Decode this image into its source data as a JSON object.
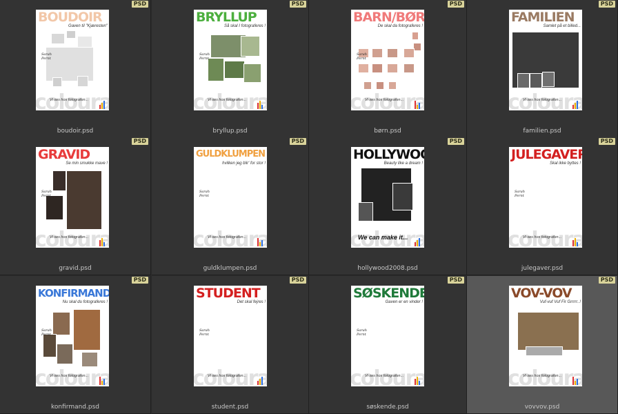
{
  "badge_label": "PSD",
  "watermark": "colourart.dk",
  "tagline": "Vi ses hos fotografen...",
  "signature": "Sarah Pernt",
  "files": [
    {
      "name": "boudoir.psd",
      "title": "BOUDOIR",
      "subtitle": "Gaven til \"Kjæresten\"",
      "title_color": "#f2c7a8",
      "selected": false
    },
    {
      "name": "bryllup.psd",
      "title": "BRYLLUP",
      "subtitle": "Så skal I fotograferes !",
      "title_color": "#4caf3e",
      "selected": false
    },
    {
      "name": "børn.psd",
      "title": "BARN/BØRN",
      "subtitle": "De skal da fotograferes !",
      "title_color": "#f07a7a",
      "selected": false
    },
    {
      "name": "familien.psd",
      "title": "FAMILIEN",
      "subtitle": "Samlet på et billed...",
      "title_color": "#9a7a62",
      "selected": false
    },
    {
      "name": "gravid.psd",
      "title": "GRAVID",
      "subtitle": "Se min smukke mave !",
      "title_color": "#e83c3c",
      "selected": false
    },
    {
      "name": "guldklumpen.psd",
      "title": "GULDKLUMPEN",
      "subtitle": "hvilken jeg blir' for stor !",
      "title_color": "#f0a040",
      "selected": false
    },
    {
      "name": "hollywood2008.psd",
      "title": "HOLLYWOOD",
      "subtitle": "Beauty like a dream !",
      "title_color": "#111111",
      "selected": false
    },
    {
      "name": "julegaver.psd",
      "title": "JULEGAVER",
      "subtitle": "Skal ikke byttes !",
      "title_color": "#d32020",
      "selected": false
    },
    {
      "name": "konfirmand.psd",
      "title": "KONFIRMAND",
      "subtitle": "Nu skal du fotograferes !",
      "title_color": "#3a78d8",
      "selected": false
    },
    {
      "name": "student.psd",
      "title": "STUDENT",
      "subtitle": "Det skal fejres !",
      "title_color": "#d42020",
      "selected": false
    },
    {
      "name": "søskende.psd",
      "title": "SØSKENDE",
      "subtitle": "Gaven er en vinder !",
      "title_color": "#1f7a3a",
      "selected": false
    },
    {
      "name": "vovvov.psd",
      "title": "VOV-VOV",
      "subtitle": "Vuf-vuf Vuf Fir Grrrrr..!",
      "title_color": "#8a4a2a",
      "selected": true
    }
  ],
  "hollywood_tagline": "We can make it..."
}
